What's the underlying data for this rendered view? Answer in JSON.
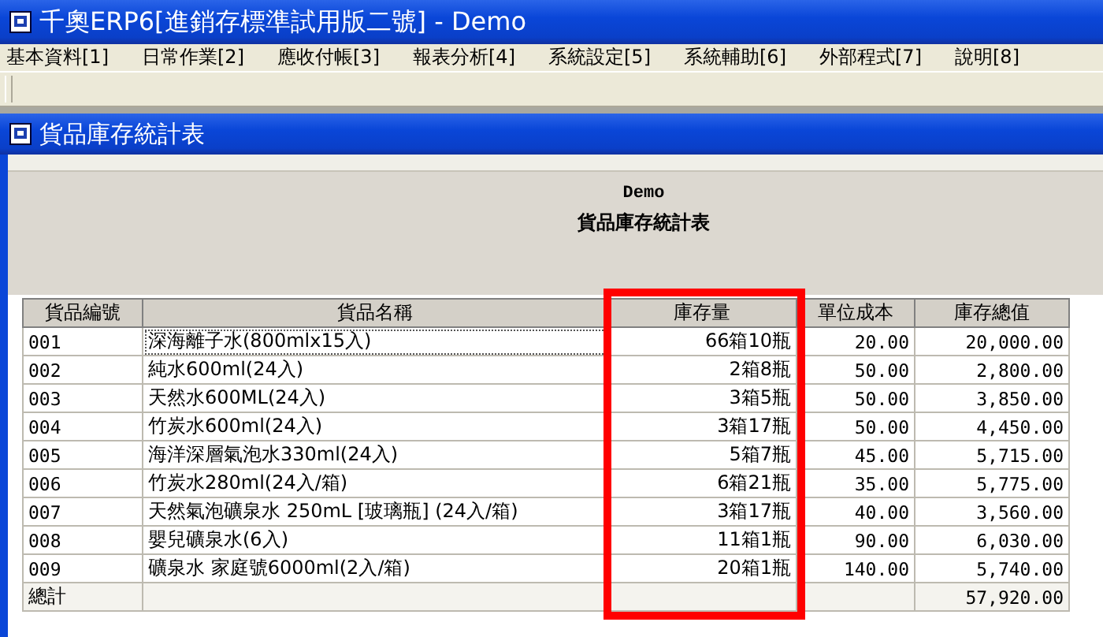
{
  "window": {
    "title": "千奧ERP6[進銷存標準試用版二號] - Demo"
  },
  "menu": [
    "基本資料[1]",
    "日常作業[2]",
    "應收付帳[3]",
    "報表分析[4]",
    "系統設定[5]",
    "系統輔助[6]",
    "外部程式[7]",
    "說明[8]"
  ],
  "report_window": {
    "title": "貨品庫存統計表"
  },
  "report": {
    "company": "Demo",
    "heading": "貨品庫存統計表"
  },
  "table": {
    "columns": [
      {
        "label": "貨品編號",
        "highlighted": false
      },
      {
        "label": "貨品名稱",
        "highlighted": false
      },
      {
        "label": "庫存量",
        "highlighted": true
      },
      {
        "label": "單位成本",
        "highlighted": false
      },
      {
        "label": "庫存總值",
        "highlighted": false
      }
    ],
    "rows": [
      [
        "001",
        "深海離子水(800mlx15入)",
        "66箱10瓶",
        "20.00",
        "20,000.00"
      ],
      [
        "002",
        "純水600ml(24入)",
        "2箱8瓶",
        "50.00",
        "2,800.00"
      ],
      [
        "003",
        "天然水600ML(24入)",
        "3箱5瓶",
        "50.00",
        "3,850.00"
      ],
      [
        "004",
        "竹炭水600ml(24入)",
        "3箱17瓶",
        "50.00",
        "4,450.00"
      ],
      [
        "005",
        "海洋深層氣泡水330ml(24入)",
        "5箱7瓶",
        "45.00",
        "5,715.00"
      ],
      [
        "006",
        "竹炭水280ml(24入/箱)",
        "6箱21瓶",
        "35.00",
        "5,775.00"
      ],
      [
        "007",
        "天然氣泡礦泉水 250mL [玻璃瓶] (24入/箱)",
        "3箱17瓶",
        "40.00",
        "3,560.00"
      ],
      [
        "008",
        "嬰兒礦泉水(6入)",
        "11箱1瓶",
        "90.00",
        "6,030.00"
      ],
      [
        "009",
        "礦泉水 家庭號6000ml(2入/箱)",
        "20箱1瓶",
        "140.00",
        "5,740.00"
      ]
    ],
    "total": {
      "label": "總計",
      "value": "57,920.00"
    }
  }
}
